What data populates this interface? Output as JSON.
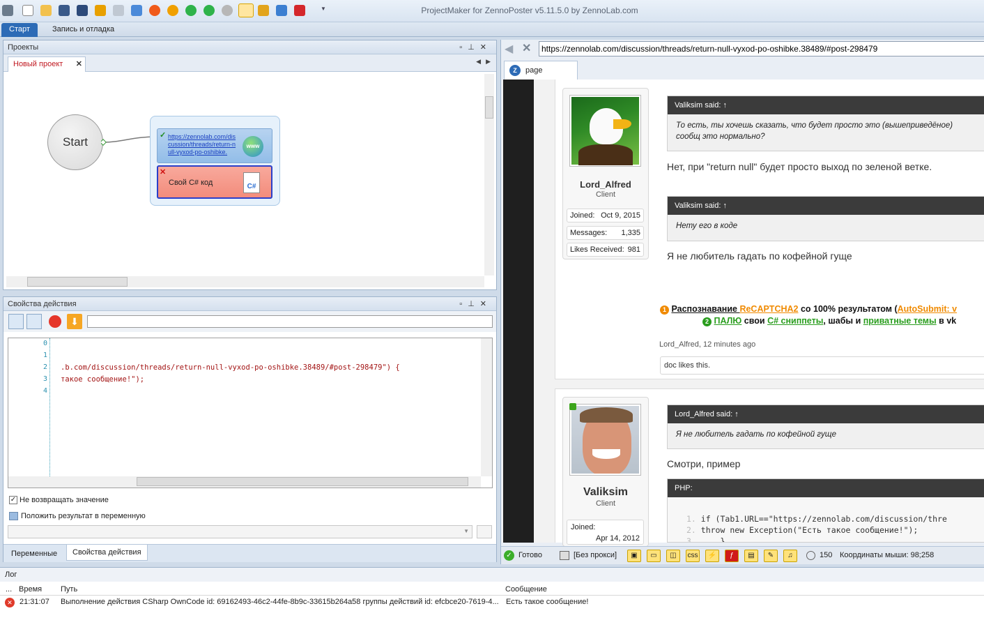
{
  "window": {
    "title": "ProjectMaker for ZennoPoster v5.11.5.0 by ZennoLab.com"
  },
  "ribbon": {
    "tabs": [
      {
        "label": "Старт"
      },
      {
        "label": "Запись и отладка"
      }
    ]
  },
  "projects_panel": {
    "title": "Проекты",
    "tab": "Новый проект",
    "start_label": "Start",
    "action1_link": "https://zennolab.com/discussion/threads/return-null-vyxod-po-oshibke.",
    "action2_label": "Свой C# код"
  },
  "props_panel": {
    "title": "Свойства действия",
    "line_numbers": [
      "0",
      "1",
      "2",
      "3",
      "4"
    ],
    "code_lines": [
      "",
      "",
      ".b.com/discussion/threads/return-null-vyxod-po-oshibke.38489/#post-298479\") {",
      "такое сообщение!\");",
      ""
    ],
    "checkbox_no_return": "Не возвращать значение",
    "checkbox_put_result": "Положить результат в переменную",
    "bottom_tabs": [
      {
        "label": "Переменные"
      },
      {
        "label": "Свойства действия"
      }
    ]
  },
  "browser": {
    "url": "https://zennolab.com/discussion/threads/return-null-vyxod-po-oshibke.38489/#post-298479",
    "tab_label": "page",
    "post1": {
      "user": "Lord_Alfred",
      "role": "Client",
      "joined_label": "Joined:",
      "joined_value": "Oct 9, 2015",
      "messages_label": "Messages:",
      "messages_value": "1,335",
      "likes_label": "Likes Received:",
      "likes_value": "981",
      "quote1_author": "Valiksim said: ↑",
      "quote1_text": "То есть, ты хочешь сказать, что будет просто это (вышеприведёное) сообщ это нормально?",
      "reply1": "Нет, при \"return null\" будет просто выход по зеленой ветке.",
      "quote2_author": "Valiksim said: ↑",
      "quote2_text": "Нету его в коде",
      "reply2": "Я не любитель гадать по кофейной гуще",
      "sig1_a": "Распознавание ",
      "sig1_b": "ReCAPTCHA2",
      "sig1_c": " со 100% результатом (",
      "sig1_d": "AutoSubmit: v",
      "sig2_a": "ПАЛЮ",
      "sig2_b": " свои ",
      "sig2_c": "C# сниппеты",
      "sig2_d": ", шабы и ",
      "sig2_e": "приватные темы",
      "sig2_f": " в vk",
      "meta": "Lord_Alfred, 12 minutes ago",
      "likes": "doc likes this."
    },
    "post2": {
      "user": "Valiksim",
      "role": "Client",
      "joined_label": "Joined:",
      "joined_value": "Apr 14, 2012",
      "quote_author": "Lord_Alfred said: ↑",
      "quote_text": "Я не любитель гадать по кофейной гуще",
      "reply": "Смотри, пример",
      "code_header": "PHP:",
      "code1": "if (Tab1.URL==\"https://zennolab.com/discussion/thre",
      "code2": "throw new Exception(\"Есть такое сообщение!\");",
      "code3": "}"
    }
  },
  "statusbar": {
    "ready": "Готово",
    "proxy": "[Без прокси]",
    "count": "150",
    "mouse": "Координаты мыши: 98;258"
  },
  "log": {
    "title": "Лог",
    "columns": {
      "dots": "...",
      "time": "Время",
      "path": "Путь",
      "message": "Сообщение"
    },
    "rows": [
      {
        "time": "21:31:07",
        "path": "Выполнение действия CSharp OwnCode id: 69162493-46c2-44fe-8b9c-33615b264a58 группы действий id: efcbce20-7619-4...",
        "message": "Есть такое сообщение!"
      }
    ]
  },
  "colors": {
    "accent": "#2d6bb6",
    "error": "#e03a2a",
    "link_orange": "#f08a00",
    "link_green": "#2a9d1e"
  }
}
